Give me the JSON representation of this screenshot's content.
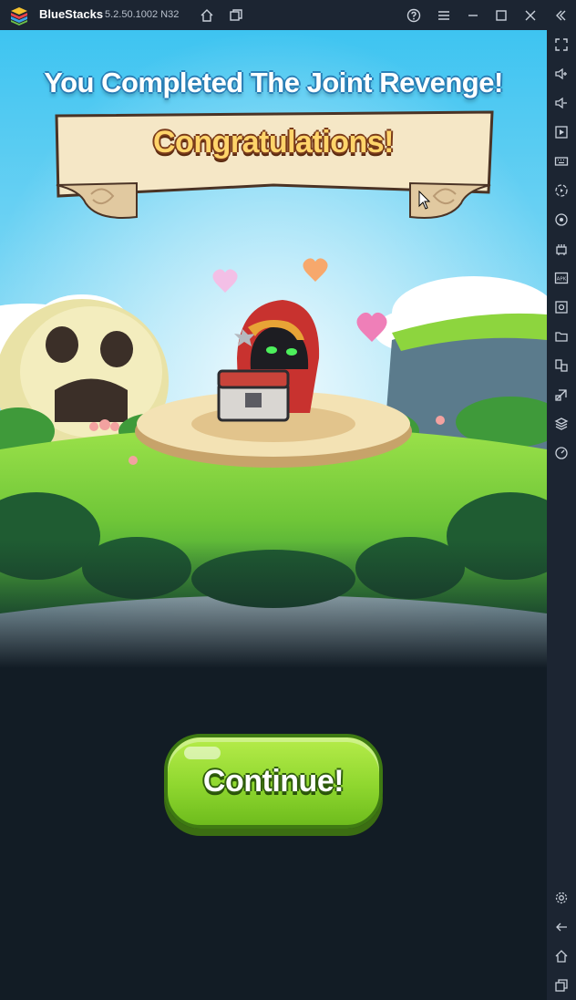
{
  "window": {
    "app_name": "BlueStacks",
    "version": "5.2.50.1002 N32",
    "buttons": [
      "home-icon",
      "multi-instance-icon",
      "help-icon",
      "menu-icon",
      "minimize-icon",
      "maximize-icon",
      "close-icon",
      "collapse-sidebar-icon"
    ]
  },
  "sidebar": {
    "items": [
      {
        "icon": "fullscreen-icon"
      },
      {
        "icon": "volume-up-icon"
      },
      {
        "icon": "volume-down-icon"
      },
      {
        "icon": "macro-play-icon"
      },
      {
        "icon": "keyboard-icon"
      },
      {
        "icon": "record-icon"
      },
      {
        "icon": "rotate-icon"
      },
      {
        "icon": "performance-icon"
      },
      {
        "icon": "apk-icon"
      },
      {
        "icon": "screenshot-icon"
      },
      {
        "icon": "folder-icon"
      },
      {
        "icon": "multi-instance-sync-icon"
      },
      {
        "icon": "eco-mode-icon"
      },
      {
        "icon": "layers-icon"
      },
      {
        "icon": "speedometer-icon"
      },
      {
        "icon": "settings-icon"
      },
      {
        "icon": "back-icon"
      },
      {
        "icon": "android-home-icon"
      },
      {
        "icon": "recent-apps-icon"
      }
    ]
  },
  "game": {
    "headline": "You Completed The Joint Revenge!",
    "banner": "Congratulations!",
    "continue_label": "Continue!"
  },
  "colors": {
    "chrome_bg": "#1c2532",
    "sky_top": "#3ec4f1",
    "grass": "#7fd33a",
    "dark_bg": "#121c25",
    "button_green": "#8fd72f",
    "banner_text": "#ffd46a"
  }
}
